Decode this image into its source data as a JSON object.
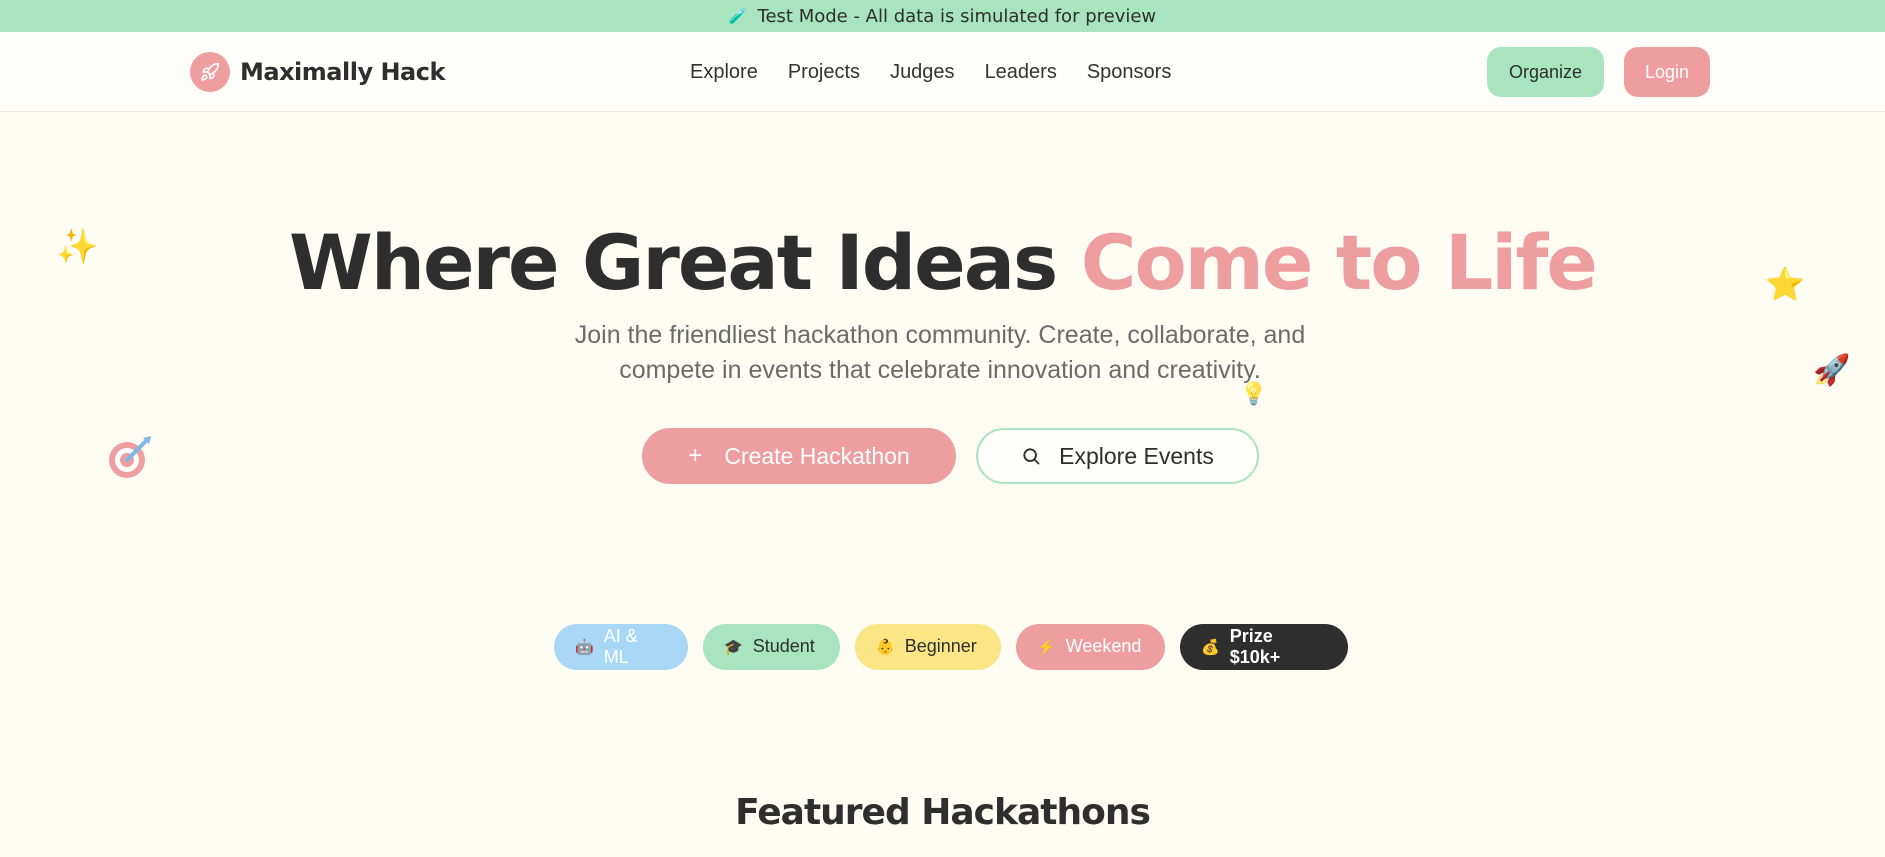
{
  "banner": {
    "icon": "test-tube-icon",
    "text": "Test Mode - All data is simulated for preview"
  },
  "brand": {
    "icon": "rocket-icon",
    "name": "Maximally Hack"
  },
  "nav": {
    "links": [
      "Explore",
      "Projects",
      "Judges",
      "Leaders",
      "Sponsors"
    ],
    "organize_label": "Organize",
    "login_label": "Login"
  },
  "hero": {
    "title_part1": "Where Great Ideas ",
    "title_part2": "Come to Life",
    "subtitle": "Join the friendliest hackathon community. Create, collaborate, and compete in events that celebrate innovation and creativity.",
    "create_label": "Create Hackathon",
    "explore_label": "Explore Events"
  },
  "tags": [
    {
      "emoji": "robot-icon",
      "label": "AI & ML"
    },
    {
      "emoji": "graduation-cap-icon",
      "label": "Student"
    },
    {
      "emoji": "baby-icon",
      "label": "Beginner"
    },
    {
      "emoji": "lightning-icon",
      "label": "Weekend"
    },
    {
      "emoji": "money-bag-icon",
      "label": "Prize $10k+"
    }
  ],
  "featured": {
    "title": "Featured Hackathons"
  },
  "colors": {
    "banner": "#a8e4bd",
    "accent_pink": "#ee9e9f",
    "accent_green": "#a8e4bd",
    "accent_blue": "#a9d8f7",
    "accent_yellow": "#fbe686",
    "dark": "#2e2e2e",
    "background": "#fffcf4"
  }
}
